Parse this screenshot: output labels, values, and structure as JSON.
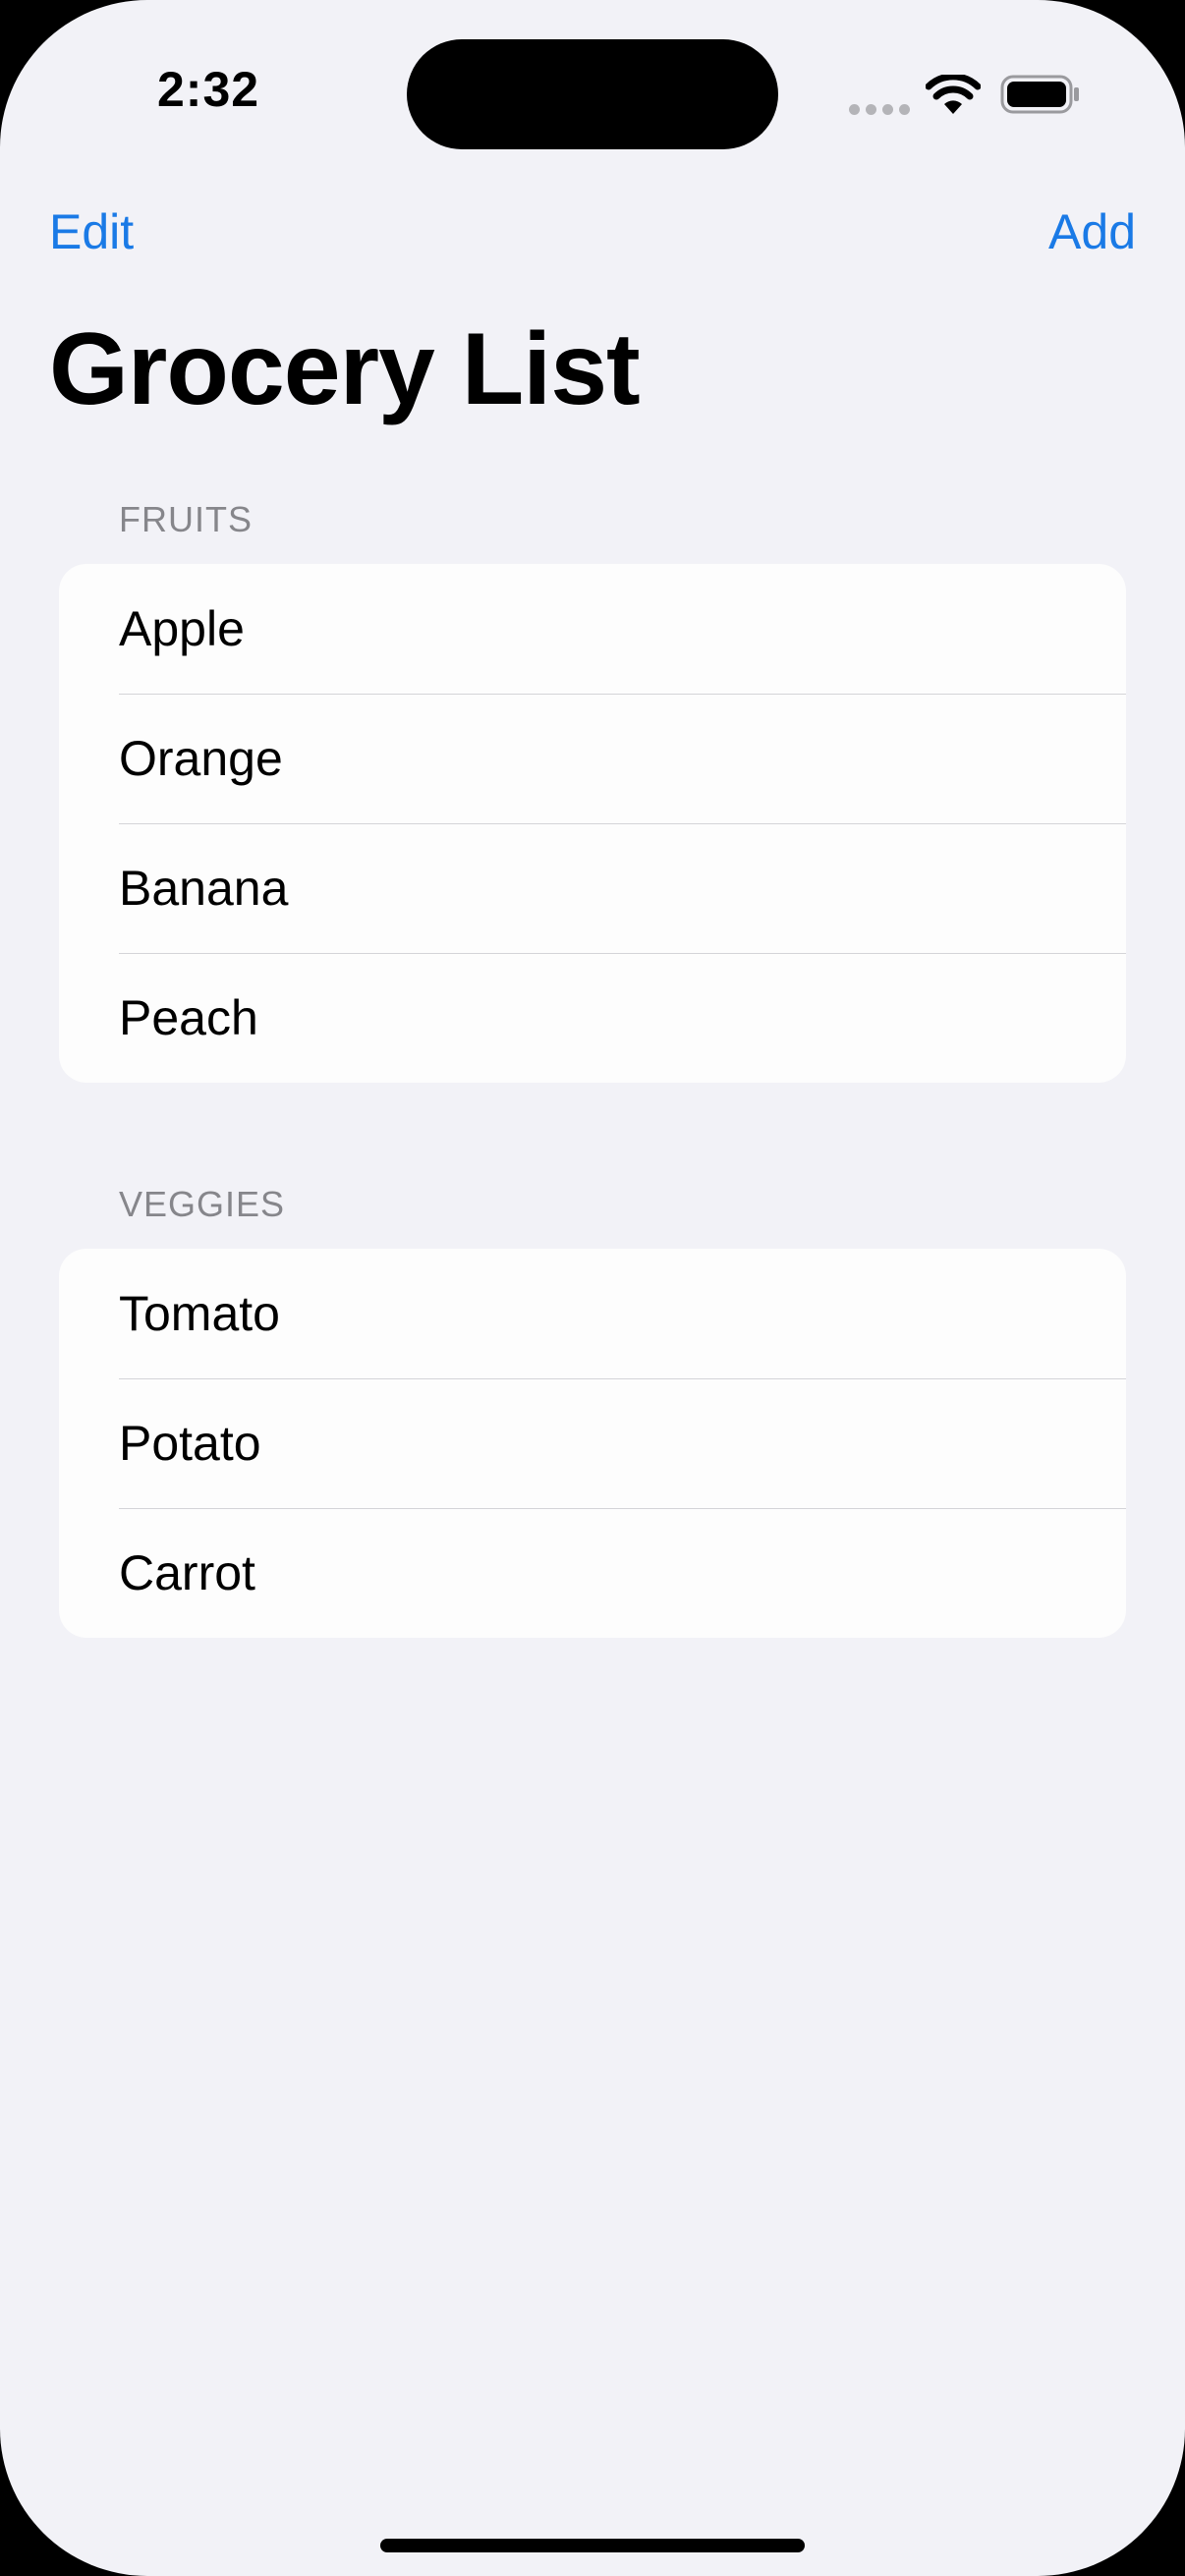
{
  "status_bar": {
    "time": "2:32"
  },
  "nav": {
    "edit_label": "Edit",
    "add_label": "Add",
    "accent_color": "#1a7ae6"
  },
  "title": "Grocery List",
  "sections": [
    {
      "header": "FRUITS",
      "items": [
        "Apple",
        "Orange",
        "Banana",
        "Peach"
      ]
    },
    {
      "header": "VEGGIES",
      "items": [
        "Tomato",
        "Potato",
        "Carrot"
      ]
    }
  ]
}
